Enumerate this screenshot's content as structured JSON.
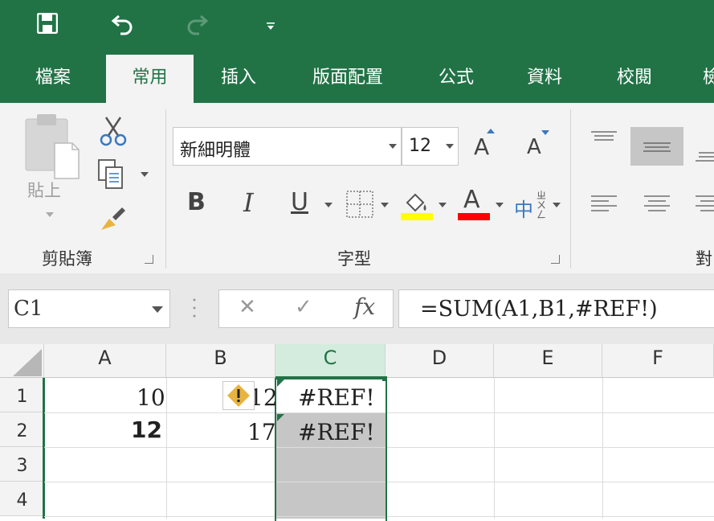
{
  "quick_access": {
    "icons": [
      "save-icon",
      "undo-icon",
      "redo-icon",
      "customize-qat-icon"
    ]
  },
  "tabs": [
    "檔案",
    "常用",
    "插入",
    "版面配置",
    "公式",
    "資料",
    "校閱",
    "檢"
  ],
  "active_tab": "常用",
  "ribbon": {
    "clipboard": {
      "paste_label": "貼上",
      "group_label": "剪貼簿"
    },
    "font": {
      "font_name": "新細明體",
      "font_size": "12",
      "bold": "B",
      "italic": "I",
      "underline": "U",
      "font_color_letter": "A",
      "grow_letter": "A",
      "shrink_letter": "A",
      "phonetic": "中",
      "group_label": "字型",
      "fill_color": "#FFFF00",
      "font_color": "#FF0000"
    },
    "alignment": {
      "group_label": "對"
    }
  },
  "formula_bar": {
    "name_box": "C1",
    "cancel": "✕",
    "enter": "✓",
    "fx": "fx",
    "formula": "=SUM(A1,B1,#REF!)"
  },
  "sheet": {
    "columns": [
      "A",
      "B",
      "C",
      "D",
      "E",
      "F"
    ],
    "rows": [
      "1",
      "2",
      "3",
      "4"
    ],
    "cells": {
      "A1": "10",
      "B1": "12",
      "C1": "#REF!",
      "A2": "12",
      "B2": "17",
      "C2": "#REF!"
    },
    "selected_cell": "C1",
    "selected_column": "C"
  },
  "colors": {
    "accent": "#217346",
    "selection_fill": "#c6c6c6",
    "header_selected": "#d3ecdd"
  }
}
